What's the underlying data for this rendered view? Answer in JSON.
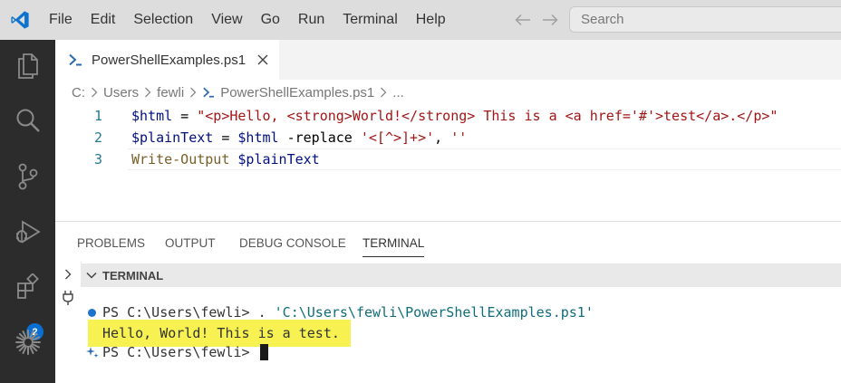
{
  "menu": [
    "File",
    "Edit",
    "Selection",
    "View",
    "Go",
    "Run",
    "Terminal",
    "Help"
  ],
  "search": {
    "placeholder": "Search"
  },
  "activity_bar": {
    "icons": [
      "explorer-icon",
      "search-icon",
      "source-control-icon",
      "run-debug-icon",
      "extensions-icon",
      "sparkle-icon"
    ],
    "extensions_badge": "2"
  },
  "tab": {
    "label": "PowerShellExamples.ps1",
    "close": "×"
  },
  "breadcrumb": {
    "items": [
      "C:",
      "Users",
      "fewli",
      "PowerShellExamples.ps1",
      "..."
    ]
  },
  "editor": {
    "lines": [
      {
        "num": "1",
        "tokens": [
          [
            "v",
            "$html"
          ],
          [
            "op",
            " = "
          ],
          [
            "s",
            "\"<p>Hello, <strong>World!</strong> This is a <a href='#'>test</a>.</p>\""
          ]
        ]
      },
      {
        "num": "2",
        "tokens": [
          [
            "v",
            "$plainText"
          ],
          [
            "op",
            " = "
          ],
          [
            "v",
            "$html"
          ],
          [
            "op",
            " -replace "
          ],
          [
            "s",
            "'<[^>]+>'"
          ],
          [
            "p",
            ", "
          ],
          [
            "s",
            "''"
          ]
        ]
      },
      {
        "num": "3",
        "tokens": [
          [
            "cmd",
            "Write-Output"
          ],
          [
            "op",
            " "
          ],
          [
            "v",
            "$plainText"
          ]
        ]
      }
    ]
  },
  "panel": {
    "tabs": [
      "PROBLEMS",
      "OUTPUT",
      "DEBUG CONSOLE",
      "TERMINAL"
    ],
    "active_tab": "TERMINAL",
    "section_title": "TERMINAL"
  },
  "terminal": {
    "line1_prompt": "PS C:\\Users\\fewli> ",
    "line1_cmd": ". ",
    "line1_path": "'C:\\Users\\fewli\\PowerShellExamples.ps1'",
    "output": "Hello, World! This is a test.",
    "line3_prompt": "PS C:\\Users\\fewli> "
  },
  "colors": {
    "activity_bar": "#2c2c2c",
    "title_bar": "#dddddd",
    "highlight": "#f7f251",
    "accent": "#0a6fd1"
  }
}
